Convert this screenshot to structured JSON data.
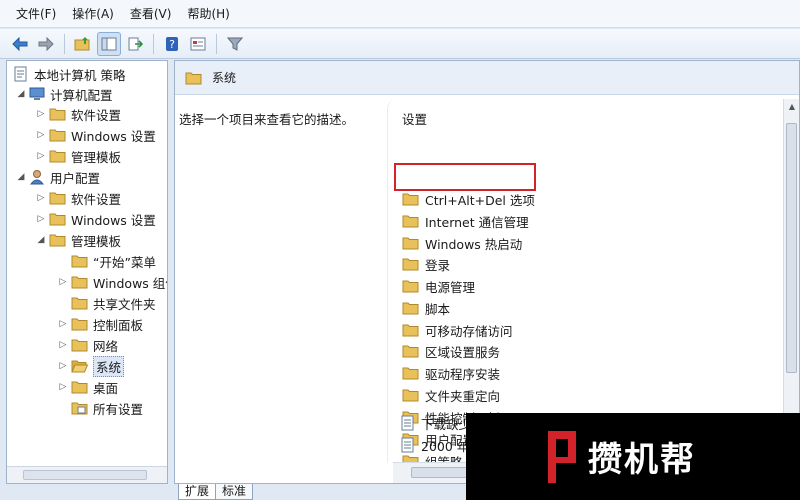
{
  "menu": {
    "items": [
      "文件(F)",
      "操作(A)",
      "查看(V)",
      "帮助(H)"
    ]
  },
  "toolbar": {
    "buttons": [
      "back-arrow-icon",
      "forward-arrow-icon",
      "up-folder-icon",
      "show-hide-tree-icon",
      "export-list-icon",
      "help-icon",
      "properties-icon",
      "filter-icon"
    ]
  },
  "tree": {
    "root": "本地计算机 策略",
    "computer_config": "计算机配置",
    "cc_software": "软件设置",
    "cc_windows": "Windows 设置",
    "cc_admin": "管理模板",
    "user_config": "用户配置",
    "uc_software": "软件设置",
    "uc_windows": "Windows 设置",
    "uc_admin": "管理模板",
    "start_menu": "“开始”菜单",
    "windows_components": "Windows 组件",
    "shared_folders": "共享文件夹",
    "control_panel": "控制面板",
    "network": "网络",
    "system": "系统",
    "desktop": "桌面",
    "all_settings": "所有设置"
  },
  "right": {
    "header_title": "系统",
    "description": "选择一个项目来查看它的描述。",
    "column_header": "设置",
    "items": [
      "Ctrl+Alt+Del 选项",
      "Internet 通信管理",
      "Windows 热启动",
      "登录",
      "电源管理",
      "脚本",
      "可移动存储访问",
      "区域设置服务",
      "驱动程序安装",
      "文件夹重定向",
      "性能控制面板",
      "用户配置文件",
      "组策略",
      "下载缺少的 COM 组件",
      "2000 年解释"
    ]
  },
  "tabs": {
    "extended": "扩展",
    "standard": "标准"
  },
  "watermark": {
    "text": "攒机帮"
  },
  "colors": {
    "highlight_border": "#d2232a",
    "folder": "#e9c15a",
    "selection": "#dbe7f6"
  }
}
